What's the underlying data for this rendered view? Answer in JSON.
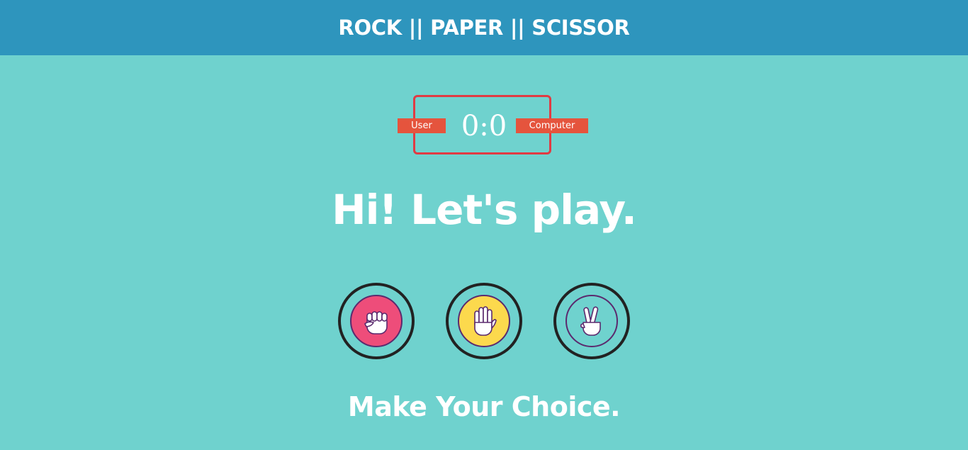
{
  "header": {
    "title": "ROCK || PAPER || SCISSOR"
  },
  "scoreboard": {
    "user_label": "User",
    "computer_label": "Computer",
    "score": "0:0",
    "border_color": "#e03b43",
    "badge_color": "#e5543d"
  },
  "result": {
    "message": "Hi! Let's play."
  },
  "choices": [
    {
      "id": "rock",
      "icon": "rock-fist-icon",
      "color": "#ee4d7a"
    },
    {
      "id": "paper",
      "icon": "paper-hand-icon",
      "color": "#fcd94d"
    },
    {
      "id": "scissors",
      "icon": "scissors-hand-icon",
      "color": "#6fd2ce"
    }
  ],
  "action": {
    "message": "Make Your Choice."
  },
  "colors": {
    "background": "#6fd2ce",
    "header": "#2e95bd"
  }
}
